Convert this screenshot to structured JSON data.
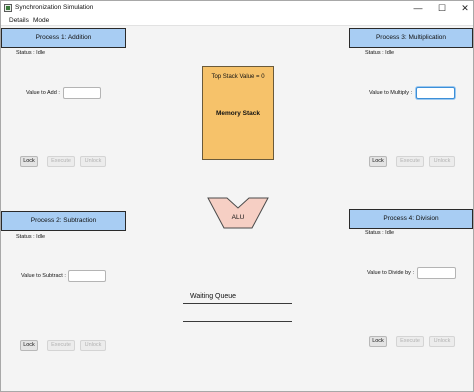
{
  "window": {
    "title": "Synchronization Simulation",
    "controls": {
      "minimize": "—",
      "maximize": "☐",
      "close": "✕"
    }
  },
  "menu": {
    "items": [
      "Details",
      "Mode"
    ]
  },
  "processes": [
    {
      "header": "Process 1: Addition",
      "status": "Status : Idle",
      "value_label": "Value to Add :",
      "value": "",
      "buttons": {
        "lock": "Lock",
        "execute": "Execute",
        "unlock": "Unlock"
      }
    },
    {
      "header": "Process 2: Subtraction",
      "status": "Status : Idle",
      "value_label": "Value to Subtract :",
      "value": "",
      "buttons": {
        "lock": "Lock",
        "execute": "Execute",
        "unlock": "Unlock"
      }
    },
    {
      "header": "Process 3: Multiplication",
      "status": "Status : Idle",
      "value_label": "Value to Multiply :",
      "value": "",
      "buttons": {
        "lock": "Lock",
        "execute": "Execute",
        "unlock": "Unlock"
      }
    },
    {
      "header": "Process 4: Division",
      "status": "Status : Idle",
      "value_label": "Value to Divide by :",
      "value": "",
      "buttons": {
        "lock": "Lock",
        "execute": "Execute",
        "unlock": "Unlock"
      }
    }
  ],
  "memory_stack": {
    "top_value_text": "Top Stack Value = 0",
    "title": "Memory Stack",
    "color": "#f6c26a"
  },
  "alu": {
    "label": "ALU",
    "color": "#f6cfc4"
  },
  "waiting_queue": {
    "label": "Waiting Queue"
  },
  "colors": {
    "process_header": "#a8cdf3",
    "disabled_text": "#b2b2b2",
    "focus_border": "#3c8fd8"
  }
}
